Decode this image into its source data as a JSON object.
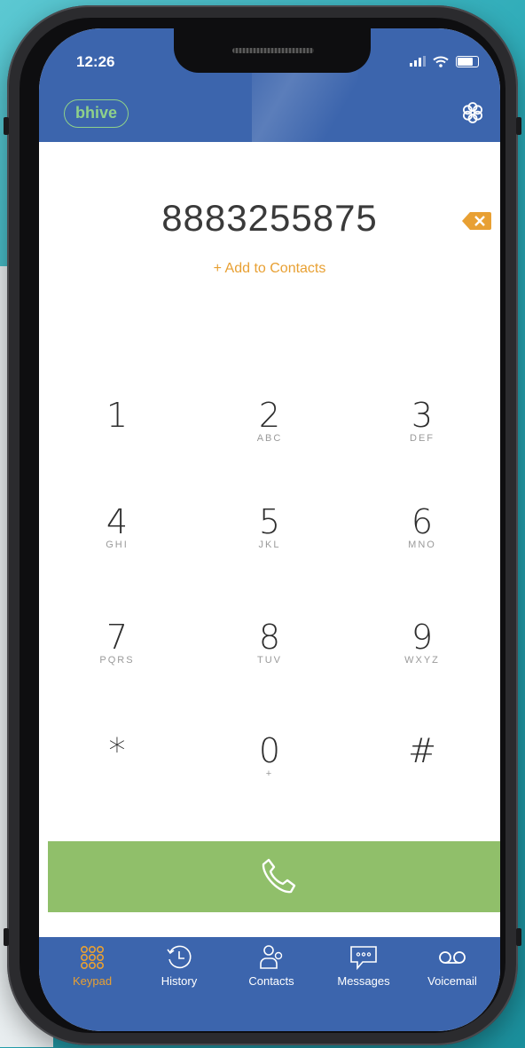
{
  "status_bar": {
    "time": "12:26"
  },
  "header": {
    "logo": "bhive"
  },
  "dialer": {
    "number": "8883255875",
    "add_to_contacts": "+ Add to Contacts"
  },
  "keypad": [
    {
      "digit": "1",
      "letters": ""
    },
    {
      "digit": "2",
      "letters": "ABC"
    },
    {
      "digit": "3",
      "letters": "DEF"
    },
    {
      "digit": "4",
      "letters": "GHI"
    },
    {
      "digit": "5",
      "letters": "JKL"
    },
    {
      "digit": "6",
      "letters": "MNO"
    },
    {
      "digit": "7",
      "letters": "PQRS"
    },
    {
      "digit": "8",
      "letters": "TUV"
    },
    {
      "digit": "9",
      "letters": "WXYZ"
    },
    {
      "digit": "*",
      "letters": ""
    },
    {
      "digit": "0",
      "letters": "+"
    },
    {
      "digit": "#",
      "letters": ""
    }
  ],
  "tabs": [
    {
      "label": "Keypad",
      "icon": "keypad-icon",
      "active": true
    },
    {
      "label": "History",
      "icon": "history-icon",
      "active": false
    },
    {
      "label": "Contacts",
      "icon": "contacts-icon",
      "active": false
    },
    {
      "label": "Messages",
      "icon": "messages-icon",
      "active": false
    },
    {
      "label": "Voicemail",
      "icon": "voicemail-icon",
      "active": false
    }
  ],
  "colors": {
    "brand_blue": "#3c65ad",
    "accent_orange": "#e8a033",
    "call_green": "#90bf6a",
    "logo_green": "#8fd18a"
  }
}
